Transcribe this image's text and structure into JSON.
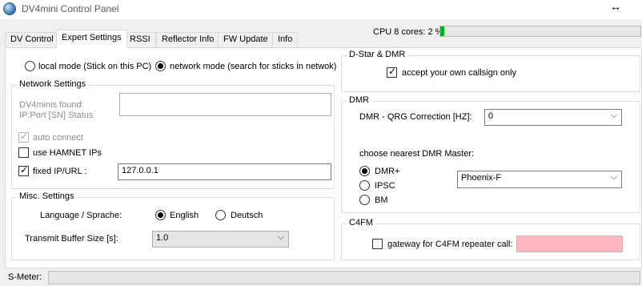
{
  "window": {
    "title": "DV4mini Control Panel",
    "icon": "app-globe-icon",
    "resize_icon": "↔"
  },
  "cpu": {
    "label": "CPU 8 cores: 2 %",
    "percent": 2,
    "fill_color": "#06b025"
  },
  "tabs": [
    {
      "label": "DV Control",
      "active": false
    },
    {
      "label": "Expert Settings",
      "active": true
    },
    {
      "label": "RSSI",
      "active": false
    },
    {
      "label": "Reflector Info",
      "active": false
    },
    {
      "label": "FW Update",
      "active": false
    },
    {
      "label": "Info",
      "active": false
    }
  ],
  "mode": {
    "local_label": "local mode (Stick on this PC)",
    "network_label": "network mode (search for sticks in netwok)",
    "selected": "network"
  },
  "network_settings": {
    "title": "Network Settings",
    "found_label_line1": "DV4minis found:",
    "found_label_line2": "IP:Port [SN] Status",
    "found_value": "",
    "auto_connect_label": "auto connect",
    "auto_connect_checked": true,
    "hamnet_label": "use HAMNET IPs",
    "hamnet_checked": false,
    "fixed_ip_label": "fixed IP/URL :",
    "fixed_ip_checked": true,
    "fixed_ip_value": "127.0.0.1"
  },
  "misc_settings": {
    "title": "Misc. Settings",
    "language_label": "Language / Sprache:",
    "english_label": "English",
    "deutsch_label": "Deutsch",
    "language_selected": "English",
    "buffer_label": "Transmit Buffer Size [s]:",
    "buffer_value": "1.0"
  },
  "dstar_dmr": {
    "title": "D-Star & DMR",
    "own_callsign_label": "accept your own callsign only",
    "own_callsign_checked": true
  },
  "dmr": {
    "title": "DMR",
    "qrg_label": "DMR - QRG Correction [HZ]:",
    "qrg_value": "0",
    "master_label": "choose nearest DMR Master:",
    "options": [
      "DMR+",
      "IPSC",
      "BM"
    ],
    "selected_option": "DMR+",
    "master_value": "Phoenix-F"
  },
  "c4fm": {
    "title": "C4FM",
    "gateway_label": "gateway for C4FM repeater call:",
    "gateway_checked": false,
    "gateway_value": "",
    "gateway_color": "#ffb6c1"
  },
  "smeter": {
    "label": "S-Meter:"
  }
}
